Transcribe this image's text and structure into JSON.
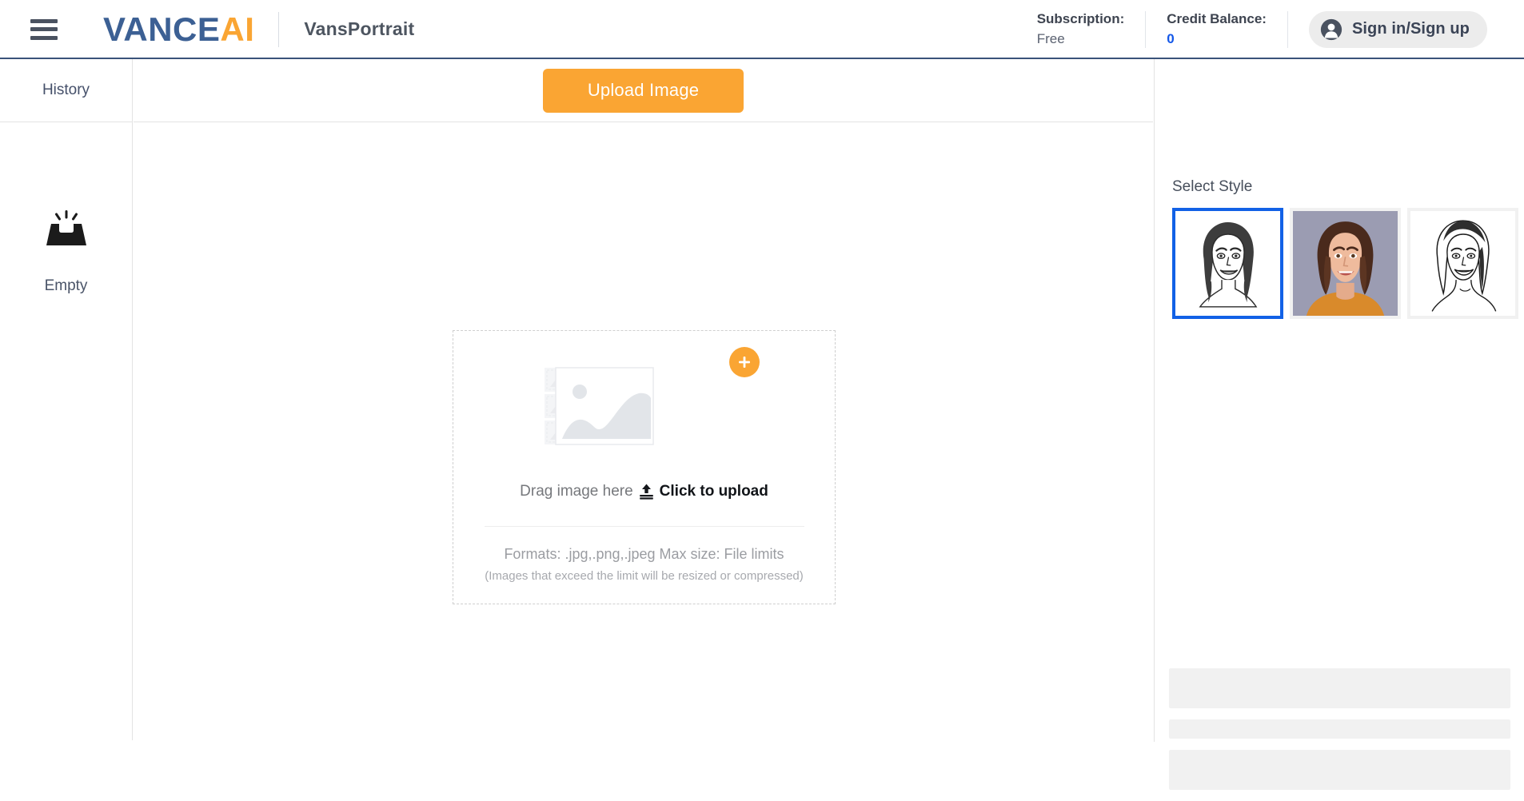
{
  "header": {
    "menu_icon": "hamburger-menu-icon",
    "logo_part1": "VANCE",
    "logo_part2": "AI",
    "app_title": "VansPortrait",
    "subscription_label": "Subscription:",
    "subscription_value": "Free",
    "credit_label": "Credit Balance:",
    "credit_value": "0",
    "signin_label": "Sign in/Sign up",
    "signin_icon": "user-avatar-icon",
    "accent_orange": "#faa533",
    "logo_blue": "#3c6094",
    "credit_blue": "#1357e8",
    "rule_color": "#3a5379"
  },
  "sidebar": {
    "history_label": "History",
    "empty_icon": "inbox-empty-icon",
    "empty_label": "Empty"
  },
  "center": {
    "upload_button_label": "Upload Image",
    "dropzone": {
      "placeholder_icon": "image-stack-placeholder-icon",
      "plus_icon": "plus-icon",
      "drag_text": "Drag image here",
      "upload_icon": "upload-arrow-icon",
      "click_text": "Click to upload",
      "formats_text": "Formats: .jpg,.png,.jpeg Max size: File limits",
      "formats_note": "(Images that exceed the limit will be resized or compressed)"
    }
  },
  "right": {
    "select_style_title": "Select Style",
    "selected_index": 0,
    "selected_border_color": "#1261e6",
    "styles": [
      {
        "name": "sketch-portrait-style",
        "selected": true
      },
      {
        "name": "color-portrait-style",
        "selected": false
      },
      {
        "name": "line-art-portrait-style",
        "selected": false
      }
    ],
    "skeletons": [
      {
        "name": "skeleton-placeholder-1"
      },
      {
        "name": "skeleton-placeholder-2"
      },
      {
        "name": "skeleton-placeholder-3"
      }
    ]
  }
}
